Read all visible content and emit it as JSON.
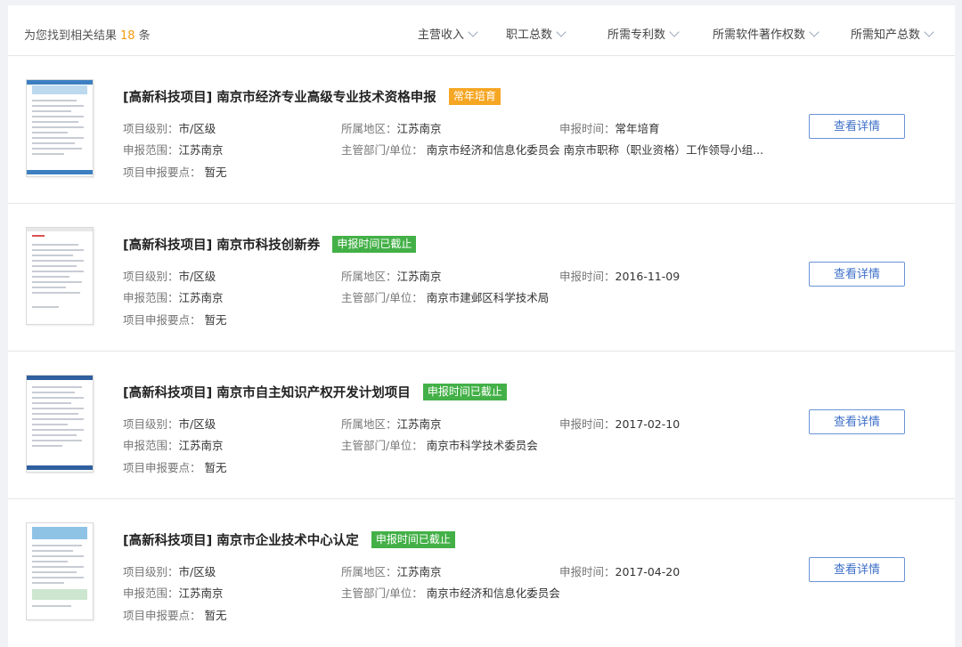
{
  "header": {
    "result_prefix": "为您找到相关结果",
    "result_count": "18",
    "result_suffix": "条",
    "sorts": [
      "主营收入",
      "职工总数",
      "所需专利数",
      "所需软件著作权数",
      "所需知产总数"
    ]
  },
  "labels": {
    "level": "项目级别：",
    "region": "所属地区：",
    "time": "申报时间：",
    "scope": "申报范围：",
    "dept": "主管部门/单位：",
    "points": "项目申报要点：",
    "detail_button": "查看详情"
  },
  "items": [
    {
      "title": "[高新科技项目] 南京市经济专业高级专业技术资格申报",
      "tag": "常年培育",
      "tag_color": "#f5a623",
      "level": "市/区级",
      "region": "江苏南京",
      "time": "常年培育",
      "scope": "江苏南京",
      "dept": "南京市经济和信息化委员会 南京市职称（职业资格）工作领导小组...",
      "points": "暂无"
    },
    {
      "title": "[高新科技项目] 南京市科技创新券",
      "tag": "申报时间已截止",
      "tag_color": "#43b047",
      "level": "市/区级",
      "region": "江苏南京",
      "time": "2016-11-09",
      "scope": "江苏南京",
      "dept": "南京市建邺区科学技术局",
      "points": "暂无"
    },
    {
      "title": "[高新科技项目] 南京市自主知识产权开发计划项目",
      "tag": "申报时间已截止",
      "tag_color": "#43b047",
      "level": "市/区级",
      "region": "江苏南京",
      "time": "2017-02-10",
      "scope": "江苏南京",
      "dept": "南京市科学技术委员会",
      "points": "暂无"
    },
    {
      "title": "[高新科技项目] 南京市企业技术中心认定",
      "tag": "申报时间已截止",
      "tag_color": "#43b047",
      "level": "市/区级",
      "region": "江苏南京",
      "time": "2017-04-20",
      "scope": "江苏南京",
      "dept": "南京市经济和信息化委员会",
      "points": "暂无"
    }
  ]
}
